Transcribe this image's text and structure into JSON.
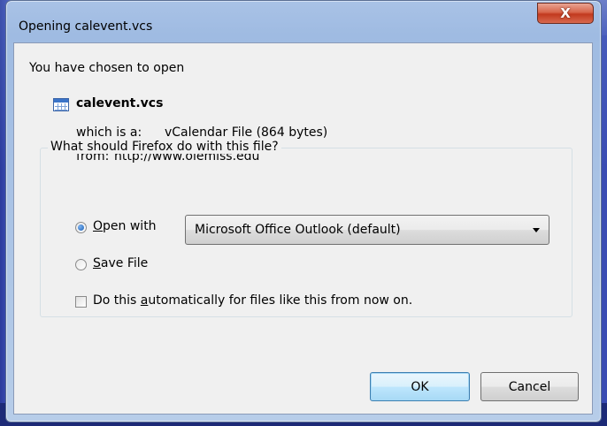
{
  "window": {
    "title": "Opening calevent.vcs",
    "close_symbol": "X"
  },
  "intro": "You have chosen to open",
  "file": {
    "icon": "calendar-file-icon",
    "name": "calevent.vcs",
    "type_label": "which is a:",
    "type_value": "vCalendar File (864 bytes)",
    "from_label": "from:",
    "from_value": "http://www.olemiss.edu"
  },
  "action_group": {
    "legend": "What should Firefox do with this file?",
    "open_with_label": "Open with",
    "open_with_checked": true,
    "open_with_app": "Microsoft Office Outlook (default)",
    "save_file_label": "Save File",
    "save_file_checked": false,
    "auto_label": "Do this automatically for files like this from now on.",
    "auto_checked": false
  },
  "buttons": {
    "ok": "OK",
    "cancel": "Cancel"
  }
}
